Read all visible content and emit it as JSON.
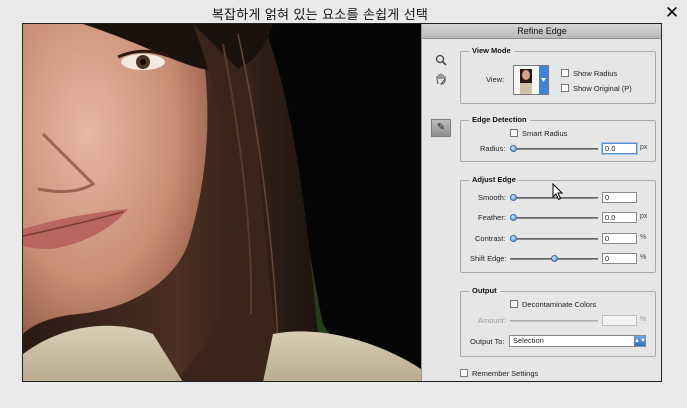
{
  "page": {
    "title": "복잡하게 얽혀 있는 요소를 손쉽게 선택",
    "close_label": "✕"
  },
  "dialog": {
    "title": "Refine Edge",
    "view_mode": {
      "legend": "View Mode",
      "view_label": "View:",
      "show_radius": {
        "label": "Show Radius",
        "checked": false
      },
      "show_original": {
        "label": "Show Original (P)",
        "checked": false
      }
    },
    "edge_detection": {
      "legend": "Edge Detection",
      "smart_radius": {
        "label": "Smart Radius",
        "checked": false
      },
      "radius": {
        "label": "Radius:",
        "value": "0.0",
        "unit": "px",
        "fraction": 0
      }
    },
    "adjust_edge": {
      "legend": "Adjust Edge",
      "smooth": {
        "label": "Smooth:",
        "value": "0",
        "unit": "",
        "fraction": 0
      },
      "feather": {
        "label": "Feather:",
        "value": "0.0",
        "unit": "px",
        "fraction": 0
      },
      "contrast": {
        "label": "Contrast:",
        "value": "0",
        "unit": "%",
        "fraction": 0
      },
      "shift_edge": {
        "label": "Shift Edge:",
        "value": "0",
        "unit": "%",
        "fraction": 0.5
      }
    },
    "output": {
      "legend": "Output",
      "decontaminate": {
        "label": "Decontaminate Colors",
        "checked": false
      },
      "amount": {
        "label": "Amount:",
        "value": "",
        "unit": "%"
      },
      "output_to": {
        "label": "Output To:",
        "value": "Selection"
      }
    },
    "remember": {
      "label": "Remember Settings",
      "checked": false
    }
  },
  "icons": {
    "zoom": "magnifier-icon",
    "hand": "hand-icon",
    "brush": "refine-radius-brush-icon",
    "close": "x-icon"
  }
}
